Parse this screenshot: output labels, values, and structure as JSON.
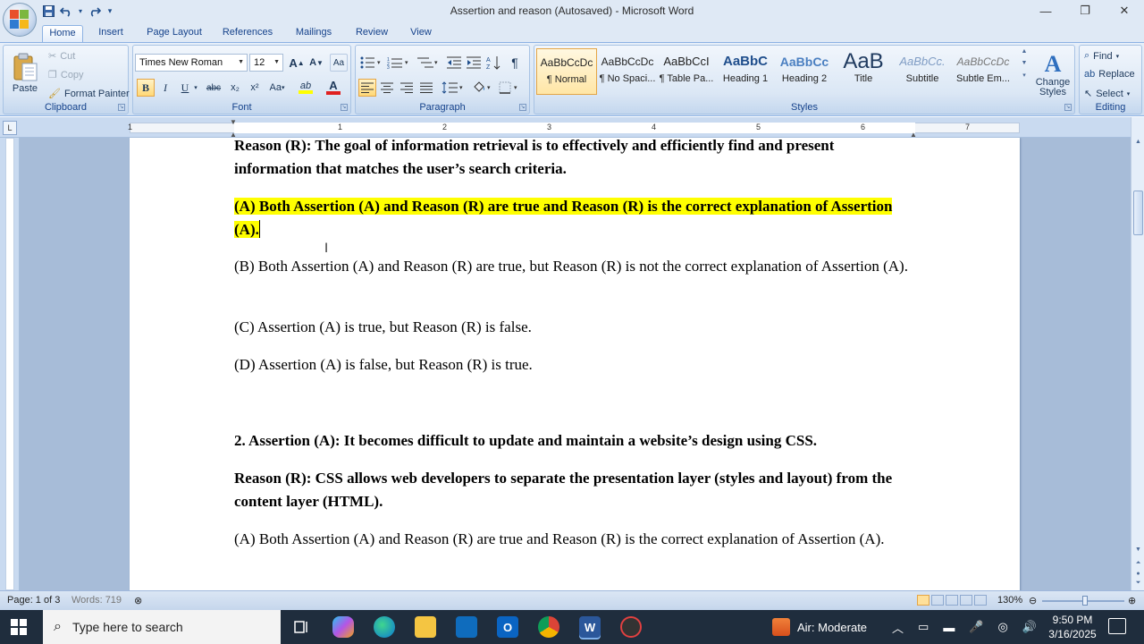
{
  "window": {
    "title": "Assertion and reason (Autosaved) - Microsoft Word",
    "minimize": "—",
    "restore": "❐",
    "close": "✕"
  },
  "qat": {
    "save_icon": "save-icon",
    "undo_icon": "undo-icon",
    "redo_icon": "redo-icon",
    "more": "▾"
  },
  "tabs": [
    "Home",
    "Insert",
    "Page Layout",
    "References",
    "Mailings",
    "Review",
    "View"
  ],
  "clipboard": {
    "paste": "Paste",
    "cut": "Cut",
    "copy": "Copy",
    "format_painter": "Format Painter",
    "label": "Clipboard"
  },
  "font": {
    "name": "Times New Roman",
    "size": "12",
    "grow": "A",
    "shrink": "A",
    "clear": "Aa",
    "bold": "B",
    "italic": "I",
    "underline": "U",
    "strike": "abc",
    "subscript": "x₂",
    "superscript": "x²",
    "change_case": "Aa",
    "highlight": "ab",
    "color": "A",
    "label": "Font",
    "highlight_color": "#ffff00",
    "font_color": "#e02020"
  },
  "paragraph": {
    "label": "Paragraph"
  },
  "styles": {
    "items": [
      {
        "sample": "AaBbCcDc",
        "name": "¶ Normal"
      },
      {
        "sample": "AaBbCcDc",
        "name": "¶ No Spaci..."
      },
      {
        "sample": "AaBbCcI",
        "name": "¶ Table Pa..."
      },
      {
        "sample": "AaBbC",
        "name": "Heading 1"
      },
      {
        "sample": "AaBbCc",
        "name": "Heading 2"
      },
      {
        "sample": "AaB",
        "name": "Title"
      },
      {
        "sample": "AaBbCc.",
        "name": "Subtitle"
      },
      {
        "sample": "AaBbCcDc",
        "name": "Subtle Em..."
      }
    ],
    "change_styles": "Change Styles",
    "label": "Styles"
  },
  "editing": {
    "find": "Find",
    "replace": "Replace",
    "select": "Select",
    "label": "Editing"
  },
  "ruler_numbers": [
    "1",
    "1",
    "2",
    "3",
    "4",
    "5",
    "6",
    "7"
  ],
  "document": {
    "p1": "Reason (R): The goal of information retrieval is to effectively and efficiently find and present information that matches the user’s search criteria.",
    "p2": " (A) Both Assertion (A) and Reason (R) are true and Reason (R) is the correct explanation of Assertion (A).",
    "p3": "(B) Both Assertion (A) and Reason (R) are true, but Reason (R) is not the correct explanation of Assertion (A).",
    "p4": " (C) Assertion (A) is true, but Reason (R) is false.",
    "p5": "(D) Assertion (A) is false, but Reason (R) is true.",
    "p6": "2. Assertion (A): It becomes difficult to update and maintain a website’s design using CSS.",
    "p7": "Reason (R): CSS allows web developers to separate the presentation layer (styles and layout) from the content layer (HTML).",
    "p8": "(A) Both Assertion (A) and Reason (R) are true and Reason (R) is the correct explanation of Assertion (A)."
  },
  "status": {
    "page": "Page: 1 of 3",
    "words": "Words: 719",
    "zoom": "130%"
  },
  "taskbar": {
    "search_placeholder": "Type here to search",
    "weather": "Air: Moderate",
    "time": "9:50 PM",
    "date": "3/16/2025"
  }
}
